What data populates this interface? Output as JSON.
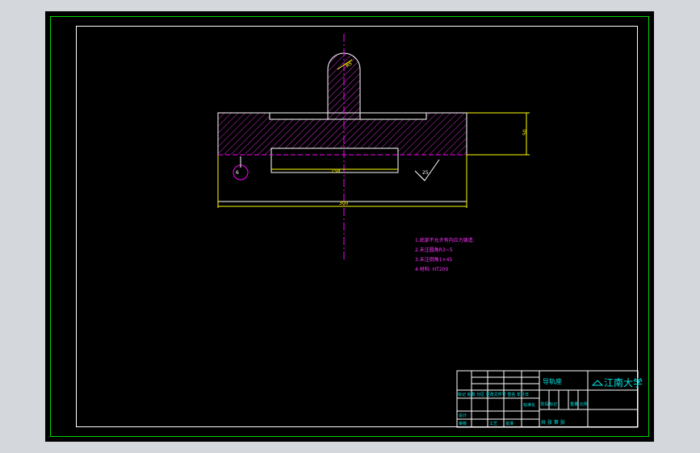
{
  "colors": {
    "background": "#000000",
    "frame_outer": "#00d400",
    "frame_inner": "#ffffff",
    "outline": "#ffffff",
    "hatch": "#cc33cc",
    "centerline": "#ff00ff",
    "dimension": "#ffff00",
    "notes": "#ff33ff",
    "title_block_text": "#00e5e5",
    "window_bg": "#d4d7dc"
  },
  "dimensions": {
    "radius_label": "R5",
    "height_label": "50",
    "inner_width_label": "158",
    "overall_width_label": "300",
    "roughness_value": "25",
    "hole_label": "6"
  },
  "notes": [
    "1.底部不允许有内应力铸造.",
    "2.未注圆角R3~5",
    "3.未注倒角1×45",
    "4.材料: HT200"
  ],
  "title_block": {
    "drawing_name": "导轨座",
    "school": "江南大学",
    "change_header": "标记 处数 分区 更改文件号 签名 年月日",
    "designer_row": "设计",
    "standard_label": "标准化",
    "stage_label": "阶段标记",
    "weight_label": "重量",
    "scale_label": "比例",
    "audit_label": "审核",
    "process_label": "工艺",
    "approve_label": "批准",
    "sheet_label": "共 张 第 张"
  }
}
